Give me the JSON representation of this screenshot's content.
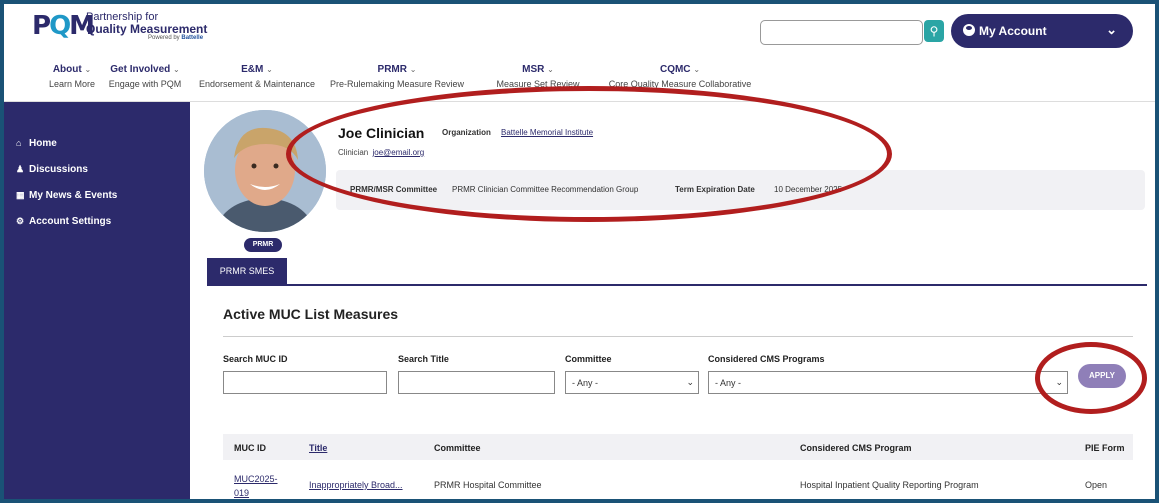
{
  "logo": {
    "mark": "PQM",
    "line1": "Partnership for",
    "line2": "Quality Measurement",
    "line3_prefix": "Powered by",
    "line3_brand": "Battelle"
  },
  "header": {
    "search_placeholder": "",
    "account_label": "My Account"
  },
  "nav": [
    {
      "title": "About",
      "sub": "Learn More"
    },
    {
      "title": "Get Involved",
      "sub": "Engage with PQM"
    },
    {
      "title": "E&M",
      "sub": "Endorsement & Maintenance"
    },
    {
      "title": "PRMR",
      "sub": "Pre-Rulemaking Measure Review"
    },
    {
      "title": "MSR",
      "sub": "Measure Set Review"
    },
    {
      "title": "CQMC",
      "sub": "Core Quality Measure Collaborative"
    }
  ],
  "sidebar": {
    "items": [
      {
        "label": "Home",
        "icon": "home-icon"
      },
      {
        "label": "Discussions",
        "icon": "users-icon"
      },
      {
        "label": "My News & Events",
        "icon": "calendar-icon"
      },
      {
        "label": "Account Settings",
        "icon": "gear-icon"
      }
    ]
  },
  "profile": {
    "name": "Joe Clinician",
    "org_label": "Organization",
    "org": "Battelle Memorial Institute",
    "role": "Clinician",
    "email": "joe@email.org",
    "badge": "PRMR",
    "committee_label": "PRMR/MSR Committee",
    "committee": "PRMR Clinician Committee Recommendation Group",
    "term_label": "Term Expiration Date",
    "term": "10 December 2025"
  },
  "tabs": [
    "PRMR SMES"
  ],
  "section_title": "Active MUC List Measures",
  "filters": {
    "muc_id_label": "Search MUC ID",
    "title_label": "Search Title",
    "committee_label": "Committee",
    "committee_value": "- Any -",
    "programs_label": "Considered CMS Programs",
    "programs_value": "- Any -",
    "apply_label": "APPLY"
  },
  "table": {
    "headers": [
      "MUC ID",
      "Title",
      "Committee",
      "Considered CMS Program",
      "PIE Form"
    ],
    "rows": [
      [
        "MUC2025-019",
        "Inappropriately Broad...",
        "PRMR Hospital Committee",
        "Hospital Inpatient Quality Reporting Program",
        "Open"
      ]
    ]
  },
  "colors": {
    "brand": "#2c2a6b",
    "accent": "#2aa5a5",
    "apply": "#8f7fb8",
    "annotation": "#b11e1e"
  }
}
